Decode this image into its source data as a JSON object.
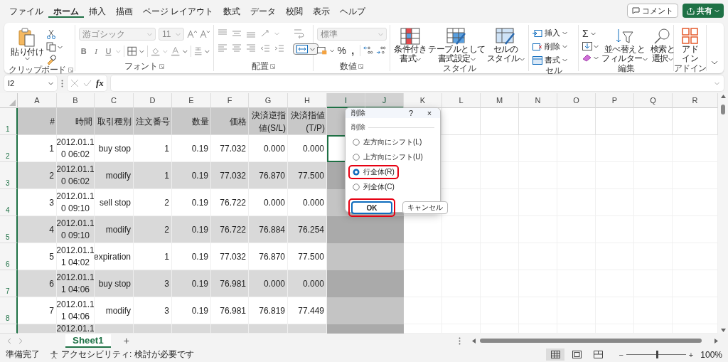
{
  "menu_tabs": [
    {
      "label": "ファイル",
      "selected": false
    },
    {
      "label": "ホーム",
      "selected": true
    },
    {
      "label": "挿入",
      "selected": false
    },
    {
      "label": "描画",
      "selected": false
    },
    {
      "label": "ページ レイアウト",
      "selected": false
    },
    {
      "label": "数式",
      "selected": false
    },
    {
      "label": "データ",
      "selected": false
    },
    {
      "label": "校閲",
      "selected": false
    },
    {
      "label": "表示",
      "selected": false
    },
    {
      "label": "ヘルプ",
      "selected": false
    }
  ],
  "header_buttons": {
    "comment": "コメント",
    "share": "共有"
  },
  "ribbon": {
    "clipboard": {
      "paste": "貼り付け",
      "group": "クリップボード"
    },
    "font": {
      "family": "游ゴシック",
      "size": "11",
      "bold": "B",
      "italic": "I",
      "underline": "U",
      "group": "フォント"
    },
    "alignment": {
      "group": "配置"
    },
    "number": {
      "format": "標準",
      "percent": "%",
      "comma": ",",
      "group": "数値"
    },
    "styles": {
      "buttons": [
        [
          "条件付き",
          "書式"
        ],
        [
          "テーブルとして",
          "書式設定"
        ],
        [
          "セルの",
          "スタイル"
        ]
      ],
      "group": "スタイル"
    },
    "cells": {
      "buttons": [
        "挿入",
        "削除",
        "書式"
      ],
      "group": "セル"
    },
    "editing": {
      "sum": "Σ",
      "buttons": [
        [
          "並べ替えと",
          "フィルター"
        ],
        [
          "検索と",
          "選択"
        ]
      ],
      "group": "編集"
    },
    "addins": {
      "button": [
        "アド",
        "イン"
      ],
      "group": "アドイン"
    }
  },
  "formula_bar": {
    "name_box": "I2",
    "fx": "fx"
  },
  "sheet": {
    "columns": [
      {
        "label": "A",
        "selected": false,
        "active": false
      },
      {
        "label": "B",
        "selected": false,
        "active": false
      },
      {
        "label": "C",
        "selected": false,
        "active": false
      },
      {
        "label": "D",
        "selected": false,
        "active": false
      },
      {
        "label": "E",
        "selected": false,
        "active": false
      },
      {
        "label": "F",
        "selected": false,
        "active": false
      },
      {
        "label": "G",
        "selected": false,
        "active": false
      },
      {
        "label": "H",
        "selected": false,
        "active": false
      },
      {
        "label": "I",
        "selected": true,
        "active": true
      },
      {
        "label": "J",
        "selected": true,
        "active": false
      },
      {
        "label": "K",
        "selected": false,
        "active": false
      },
      {
        "label": "L",
        "selected": false,
        "active": false
      },
      {
        "label": "M",
        "selected": false,
        "active": false
      },
      {
        "label": "N",
        "selected": false,
        "active": false
      },
      {
        "label": "O",
        "selected": false,
        "active": false
      },
      {
        "label": "P",
        "selected": false,
        "active": false
      },
      {
        "label": "Q",
        "selected": false,
        "active": false
      },
      {
        "label": "R",
        "selected": false,
        "active": false
      }
    ],
    "header_row": {
      "number": "1",
      "cells": [
        "#",
        "時間",
        "取引種別",
        "注文番号",
        "数量",
        "価格",
        [
          "決済逆指",
          "値(S/L)"
        ],
        [
          "決済指値",
          "(T/P)"
        ]
      ]
    },
    "rows": [
      {
        "number": "2",
        "shaded": false,
        "active": true,
        "cells": [
          "1",
          "2012.01.1\n0 06:02",
          "buy stop",
          "1",
          "0.19",
          "77.032",
          "0.000",
          "0.000"
        ]
      },
      {
        "number": "3",
        "shaded": true,
        "active": false,
        "cells": [
          "2",
          "2012.01.1\n0 06:02",
          "modify",
          "1",
          "0.19",
          "77.032",
          "76.870",
          "77.500"
        ]
      },
      {
        "number": "4",
        "shaded": false,
        "active": false,
        "cells": [
          "3",
          "2012.01.1\n0 09:10",
          "sell stop",
          "2",
          "0.19",
          "76.722",
          "0.000",
          "0.000"
        ]
      },
      {
        "number": "5",
        "shaded": true,
        "active": false,
        "cells": [
          "4",
          "2012.01.1\n0 09:10",
          "modify",
          "2",
          "0.19",
          "76.722",
          "76.884",
          "76.254"
        ]
      },
      {
        "number": "6",
        "shaded": false,
        "active": false,
        "cells": [
          "5",
          "2012.01.1\n1 04:02",
          "expiration",
          "1",
          "0.19",
          "77.032",
          "76.870",
          "77.500"
        ]
      },
      {
        "number": "7",
        "shaded": true,
        "active": false,
        "cells": [
          "6",
          "2012.01.1\n1 04:06",
          "buy stop",
          "3",
          "0.19",
          "76.981",
          "0.000",
          "0.000"
        ]
      },
      {
        "number": "8",
        "shaded": false,
        "active": false,
        "cells": [
          "7",
          "2012.01.1\n1 04:06",
          "modify",
          "3",
          "0.19",
          "76.981",
          "76.819",
          "77.449"
        ]
      }
    ],
    "partial_row": {
      "shaded": true,
      "time": "2012.01.1"
    }
  },
  "dialog": {
    "title": "削除",
    "help": "?",
    "close": "×",
    "section": "削除",
    "options": [
      {
        "label": "左方向にシフト(L)",
        "selected": false,
        "highlighted": false
      },
      {
        "label": "上方向にシフト(U)",
        "selected": false,
        "highlighted": false
      },
      {
        "label": "行全体(R)",
        "selected": true,
        "highlighted": true
      },
      {
        "label": "列全体(C)",
        "selected": false,
        "highlighted": false
      }
    ],
    "buttons": [
      {
        "label": "OK",
        "default": true,
        "highlighted": true
      },
      {
        "label": "キャンセル",
        "default": false,
        "highlighted": false
      }
    ]
  },
  "sheet_tabs": {
    "tabs": [
      {
        "label": "Sheet1",
        "selected": true
      }
    ],
    "add": "+"
  },
  "status_bar": {
    "ready": "準備完了",
    "accessibility": "アクセシビリティ: 検討が必要です",
    "zoom_minus": "−",
    "zoom_plus": "+",
    "zoom": {
      "level": 0.5
    },
    "zoom_text": "100%"
  }
}
